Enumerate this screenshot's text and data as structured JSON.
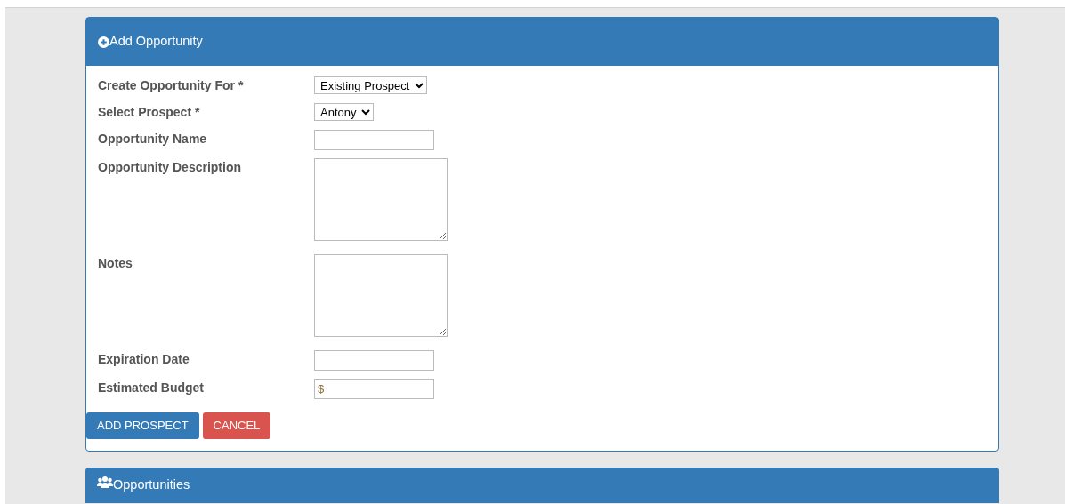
{
  "panel": {
    "title": "Add Opportunity"
  },
  "fields": [
    {
      "label": "Create Opportunity For *",
      "kind": "select",
      "value": "Existing Prospect"
    },
    {
      "label": "Select Prospect *",
      "kind": "select",
      "value": "Antony"
    },
    {
      "label": "Opportunity Name",
      "kind": "input"
    },
    {
      "label": "Opportunity Description",
      "kind": "textarea"
    },
    {
      "label": "Notes",
      "kind": "textarea"
    },
    {
      "label": "Expiration Date",
      "kind": "input"
    },
    {
      "label": "Estimated Budget",
      "kind": "input",
      "placeholder": "$"
    }
  ],
  "buttons": [
    {
      "label": "ADD PROSPECT",
      "kind": "primary"
    },
    {
      "label": "CANCEL",
      "kind": "danger"
    }
  ],
  "next_panel": {
    "title": "Opportunities"
  }
}
